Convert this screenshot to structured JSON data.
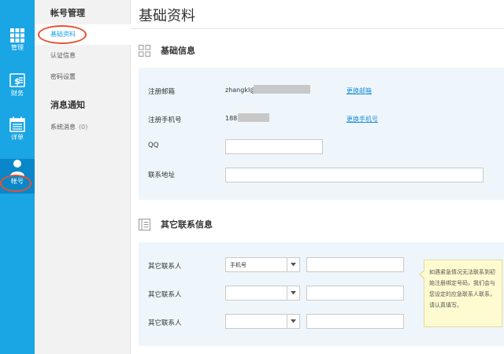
{
  "rail": {
    "items": [
      {
        "label": "管理",
        "icon": "grid-icon"
      },
      {
        "label": "财务",
        "icon": "finance-icon"
      },
      {
        "label": "详单",
        "icon": "calendar-list-icon"
      },
      {
        "label": "帐号",
        "icon": "user-icon",
        "active": true
      }
    ]
  },
  "subnav": {
    "groups": [
      {
        "title": "帐号管理",
        "items": [
          {
            "label": "基础资料",
            "active": true
          },
          {
            "label": "认证信息"
          },
          {
            "label": "密码设置"
          }
        ]
      },
      {
        "title": "消息通知",
        "items": [
          {
            "label": "系统消息",
            "count": "(0)"
          }
        ]
      }
    ]
  },
  "main": {
    "title": "基础资料",
    "basic": {
      "heading": "基础信息",
      "icon": "grid-outline-icon",
      "email_label": "注册邮箱",
      "email_value": "zhangkl@",
      "email_link": "更换邮箱",
      "phone_label": "注册手机号",
      "phone_value": "188",
      "phone_link": "更换手机号",
      "qq_label": "QQ",
      "qq_value": "",
      "address_label": "联系地址",
      "address_value": ""
    },
    "other": {
      "heading": "其它联系信息",
      "icon": "contact-book-icon",
      "contacts": [
        {
          "label": "其它联系人",
          "type": "手机号",
          "value": ""
        },
        {
          "label": "其它联系人",
          "type": "",
          "value": ""
        },
        {
          "label": "其它联系人",
          "type": "",
          "value": ""
        }
      ],
      "tip": "如遇紧急情况无法联系到初始注册绑定号码，我们会与您设定的应急联系人联系，请认真填写。"
    }
  },
  "colors": {
    "rail": "#1aa5e4",
    "rail_active": "#0a87c8",
    "panel": "#eef6fb",
    "link": "#1a8fd8",
    "annotation": "#e8502f",
    "tip_bg": "#fffbd1"
  }
}
